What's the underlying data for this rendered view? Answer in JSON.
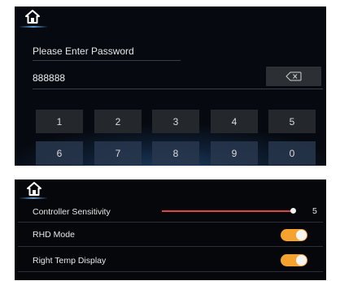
{
  "password_screen": {
    "prompt": "Please Enter Password",
    "value": "888888",
    "backspace_icon": "backspace-icon",
    "keys_row1": [
      "1",
      "2",
      "3",
      "4",
      "5"
    ],
    "keys_row2": [
      "6",
      "7",
      "8",
      "9",
      "0"
    ]
  },
  "settings_screen": {
    "home_icon": "home-icon",
    "controller_sensitivity": {
      "label": "Controller Sensitivity",
      "value": "5",
      "level": 5
    },
    "rhd_mode": {
      "label": "RHD Mode",
      "on": true
    },
    "right_temp_display": {
      "label": "Right Temp Display",
      "on": true
    }
  },
  "colors": {
    "accent_toggle": "#f6a22e",
    "slider_fill": "#e0454a",
    "panel_bg": "#05070b"
  }
}
